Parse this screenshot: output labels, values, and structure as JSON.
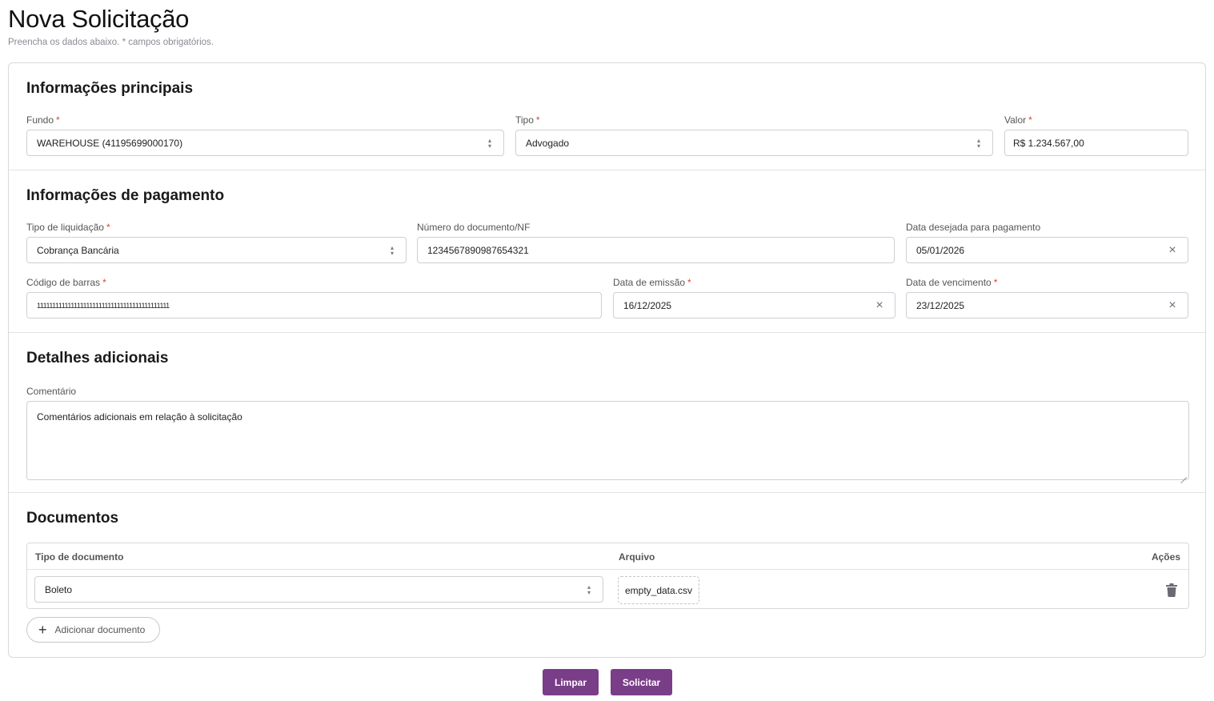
{
  "page": {
    "title": "Nova Solicitação",
    "subtitle": "Preencha os dados abaixo. * campos obrigatórios."
  },
  "required_marker": "*",
  "sections": {
    "main": {
      "title": "Informações principais",
      "fundo": {
        "label": "Fundo",
        "value": "WAREHOUSE (41195699000170)"
      },
      "tipo": {
        "label": "Tipo",
        "value": "Advogado"
      },
      "valor": {
        "label": "Valor",
        "value": "R$ 1.234.567,00"
      }
    },
    "payment": {
      "title": "Informações de pagamento",
      "tipo_liquidacao": {
        "label": "Tipo de liquidação",
        "value": "Cobrança Bancária"
      },
      "numero_documento": {
        "label": "Número do documento/NF",
        "value": "1234567890987654321"
      },
      "data_desejada": {
        "label": "Data desejada para pagamento",
        "value": "05/01/2026"
      },
      "codigo_barras": {
        "label": "Código de barras",
        "value": "1111111111111111111111111111111111111111111"
      },
      "data_emissao": {
        "label": "Data de emissão",
        "value": "16/12/2025"
      },
      "data_vencimento": {
        "label": "Data de vencimento",
        "value": "23/12/2025"
      }
    },
    "details": {
      "title": "Detalhes adicionais",
      "comentario": {
        "label": "Comentário",
        "value": "Comentários adicionais em relação à solicitação"
      }
    },
    "documents": {
      "title": "Documentos",
      "columns": {
        "tipo": "Tipo de documento",
        "arquivo": "Arquivo",
        "acoes": "Ações"
      },
      "rows": [
        {
          "tipo": "Boleto",
          "arquivo": "empty_data.csv"
        }
      ],
      "add_label": "Adicionar documento"
    }
  },
  "actions": {
    "clear_label": "Limpar",
    "submit_label": "Solicitar"
  },
  "icons": {
    "select": "chevron-up-down-icon",
    "clear": "close-icon",
    "delete": "trash-icon",
    "add": "plus-icon"
  },
  "colors": {
    "primary": "#7a3d87",
    "required": "#d9453a"
  }
}
